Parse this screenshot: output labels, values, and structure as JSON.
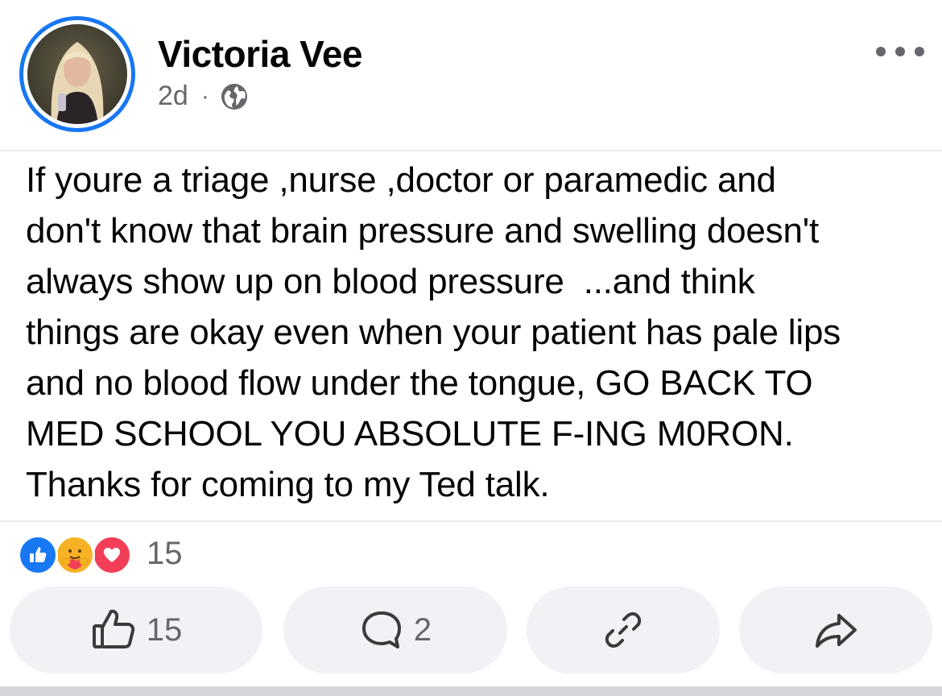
{
  "post": {
    "author_name": "Victoria Vee",
    "timestamp": "2d",
    "separator": "·",
    "audience_icon": "globe-icon",
    "more_icon": "more-options-icon",
    "text_lines": [
      "If youre a triage ,nurse ,doctor or paramedic and",
      "don't know that brain pressure and swelling doesn't",
      "always show up on blood pressure  ...and think",
      "things are okay even when your patient has pale lips",
      "and no blood flow under the tongue, GO BACK TO",
      "MED SCHOOL YOU ABSOLUTE F-ING M0RON.",
      "Thanks for coming to my Ted talk."
    ]
  },
  "reactions": {
    "icons": [
      "like-icon",
      "care-icon",
      "love-icon"
    ],
    "count": "15"
  },
  "actions": {
    "like": {
      "icon": "thumbs-up-icon",
      "label": "15"
    },
    "comment": {
      "icon": "comment-icon",
      "label": "2"
    },
    "copy_link": {
      "icon": "link-icon",
      "label": ""
    },
    "share": {
      "icon": "share-icon",
      "label": ""
    }
  },
  "colors": {
    "accent": "#1877f2",
    "love": "#f33e58",
    "care": "#f7b125",
    "secondary_text": "#65676b",
    "button_bg": "#f0f2f5"
  }
}
